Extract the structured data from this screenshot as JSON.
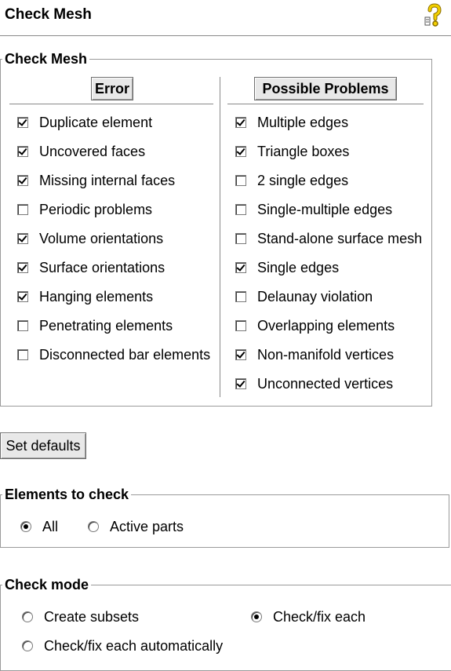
{
  "window": {
    "title": "Check Mesh",
    "help_icon": "question-mark-icon"
  },
  "check_mesh": {
    "group_title": "Check Mesh",
    "error_column": {
      "header": "Error",
      "items": [
        {
          "label": "Duplicate element",
          "checked": true
        },
        {
          "label": "Uncovered faces",
          "checked": true
        },
        {
          "label": "Missing internal faces",
          "checked": true
        },
        {
          "label": "Periodic problems",
          "checked": false
        },
        {
          "label": "Volume orientations",
          "checked": true
        },
        {
          "label": "Surface orientations",
          "checked": true
        },
        {
          "label": "Hanging elements",
          "checked": true
        },
        {
          "label": "Penetrating elements",
          "checked": false
        },
        {
          "label": "Disconnected bar elements",
          "checked": false
        }
      ]
    },
    "problems_column": {
      "header": "Possible Problems",
      "items": [
        {
          "label": "Multiple edges",
          "checked": true
        },
        {
          "label": "Triangle boxes",
          "checked": true
        },
        {
          "label": "2 single edges",
          "checked": false
        },
        {
          "label": "Single-multiple edges",
          "checked": false
        },
        {
          "label": "Stand-alone surface mesh",
          "checked": false
        },
        {
          "label": "Single edges",
          "checked": true
        },
        {
          "label": "Delaunay violation",
          "checked": false
        },
        {
          "label": "Overlapping elements",
          "checked": false
        },
        {
          "label": "Non-manifold vertices",
          "checked": true
        },
        {
          "label": "Unconnected vertices",
          "checked": true
        }
      ]
    }
  },
  "set_defaults_label": "Set defaults",
  "elements_to_check": {
    "group_title": "Elements to check",
    "options": [
      {
        "label": "All",
        "selected": true
      },
      {
        "label": "Active parts",
        "selected": false
      }
    ]
  },
  "check_mode": {
    "group_title": "Check mode",
    "options": [
      {
        "label": "Create subsets",
        "selected": false
      },
      {
        "label": "Check/fix each",
        "selected": true
      },
      {
        "label": "Check/fix each automatically",
        "selected": false
      }
    ]
  }
}
